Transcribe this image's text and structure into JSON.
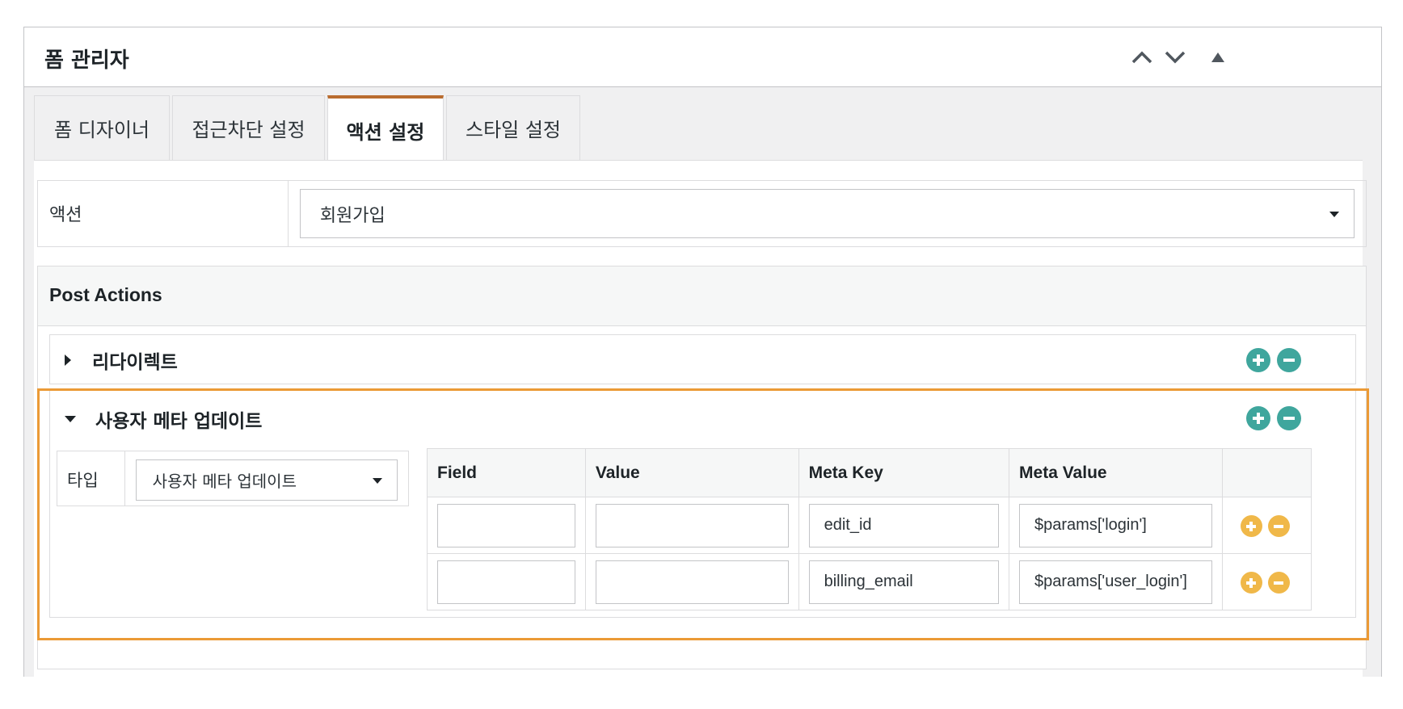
{
  "header": {
    "title": "폼 관리자",
    "buttons": [
      "chevron-up-icon",
      "chevron-down-icon",
      "triangle-up-icon"
    ]
  },
  "tabs": [
    {
      "label": "폼 디자이너",
      "active": false
    },
    {
      "label": "접근차단 설정",
      "active": false
    },
    {
      "label": "액션 설정",
      "active": true
    },
    {
      "label": "스타일 설정",
      "active": false
    }
  ],
  "action": {
    "label": "액션",
    "selected": "회원가입"
  },
  "post_actions": {
    "title": "Post Actions",
    "items": [
      {
        "label": "리다이렉트",
        "expanded": false
      },
      {
        "label": "사용자 메타 업데이트",
        "expanded": true
      }
    ]
  },
  "meta_update": {
    "type_label": "타입",
    "type_value": "사용자 메타 업데이트",
    "columns": [
      "Field",
      "Value",
      "Meta Key",
      "Meta Value"
    ],
    "rows": [
      {
        "field": "",
        "value": "",
        "meta_key": "edit_id",
        "meta_value": "$params['login']"
      },
      {
        "field": "",
        "value": "",
        "meta_key": "billing_email",
        "meta_value": "$params['user_login']"
      }
    ]
  },
  "colors": {
    "tab_accent": "#b96c2f",
    "highlight": "#eb9a36",
    "teal_button": "#3fa69d",
    "yellow_button": "#f0b849"
  }
}
